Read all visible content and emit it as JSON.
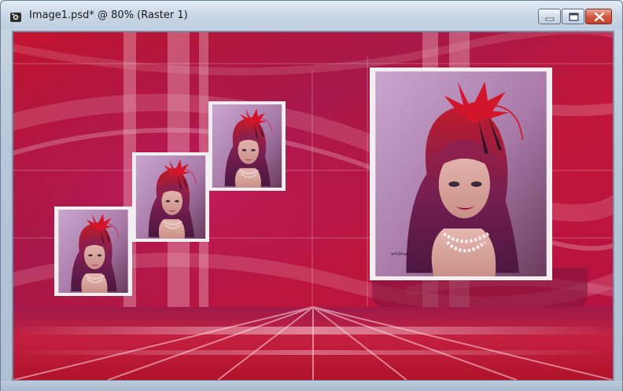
{
  "window": {
    "title": "Image1.psd* @  80% (Raster 1)",
    "controls": {
      "minimize": "minimize",
      "maximize": "maximize",
      "close": "close"
    }
  },
  "canvas": {
    "description_icon": "picture-icon",
    "artwork": {
      "signature": "artUlman",
      "thumbnails": 3,
      "colors": {
        "primary": "#c8103a",
        "secondary": "#9a1c5c",
        "highlight": "#f2c9d4",
        "frame": "#f5eef0"
      }
    }
  }
}
